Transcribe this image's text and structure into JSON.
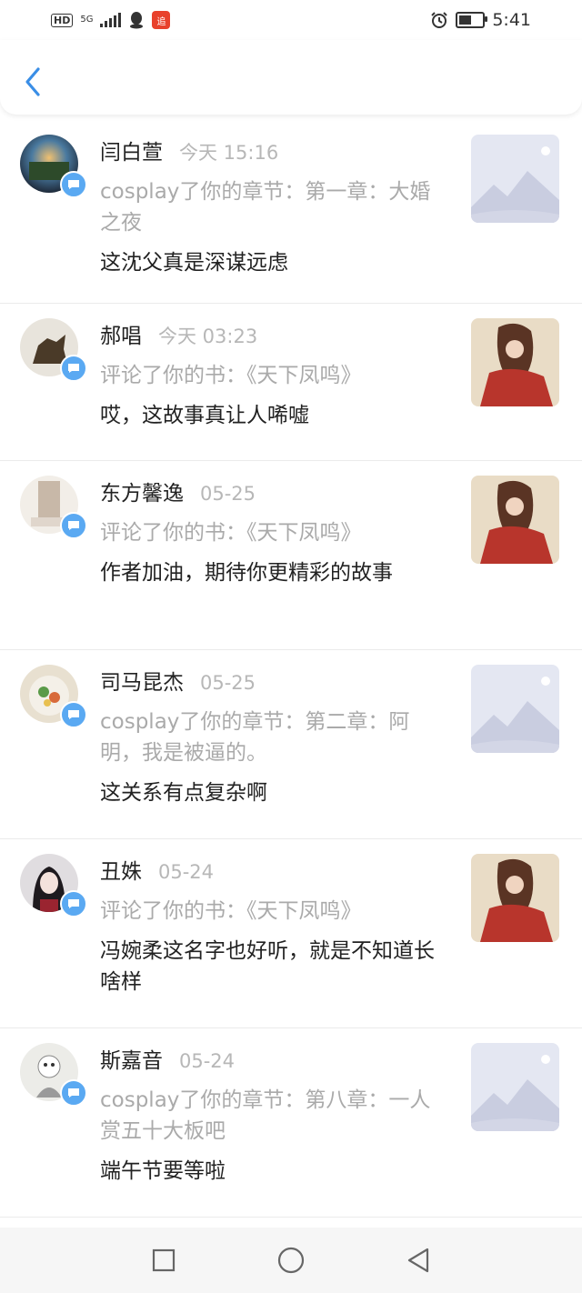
{
  "status_bar": {
    "hd": "HD",
    "network": "5G",
    "time": "5:41",
    "app_badge": "追"
  },
  "header": {
    "back_icon": "chevron-left-icon"
  },
  "notifications": [
    {
      "name": "闫白萱",
      "time": "今天 15:16",
      "reference": "cosplay了你的章节：第一章：大婚之夜",
      "comment": "这沈父真是深谋远虑",
      "thumb": "placeholder"
    },
    {
      "name": "郝唱",
      "time": "今天 03:23",
      "reference": "评论了你的书：《天下凤鸣》",
      "comment": "哎，这故事真让人唏嘘",
      "thumb": "cover"
    },
    {
      "name": "东方馨逸",
      "time": "05-25",
      "reference": "评论了你的书：《天下凤鸣》",
      "comment": "作者加油，期待你更精彩的故事",
      "thumb": "cover"
    },
    {
      "name": "司马昆杰",
      "time": "05-25",
      "reference": "cosplay了你的章节：第二章：阿明，我是被逼的。",
      "comment": "这关系有点复杂啊",
      "thumb": "placeholder"
    },
    {
      "name": "丑姝",
      "time": "05-24",
      "reference": "评论了你的书：《天下凤鸣》",
      "comment": "冯婉柔这名字也好听，就是不知道长啥样",
      "thumb": "cover"
    },
    {
      "name": "斯嘉音",
      "time": "05-24",
      "reference": "cosplay了你的章节：第八章：一人赏五十大板吧",
      "comment": "端午节要等啦",
      "thumb": "placeholder"
    }
  ],
  "colors": {
    "accent": "#5aa9f2",
    "secondary_text": "#aaaaaa",
    "divider": "#ebebeb"
  }
}
